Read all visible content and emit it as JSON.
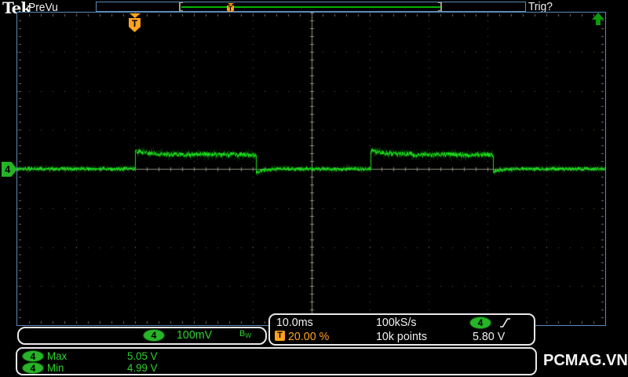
{
  "header": {
    "logo": "Tek",
    "mode": "PreVu",
    "trigger_status": "Trig?"
  },
  "record_bar": {
    "trigger_marker": "T"
  },
  "trigger_position_marker": "T",
  "channel_marker": {
    "channel": "4"
  },
  "channel_readout": {
    "channel": "4",
    "volts_per_div": "100mV",
    "bandwidth_b": "B",
    "bandwidth_w": "W"
  },
  "horizontal_readout": {
    "time_per_div": "10.0ms",
    "sample_rate": "100kS/s",
    "record_length": "10k points"
  },
  "trigger_readout": {
    "marker": "T",
    "position": "20.00 %",
    "source_channel": "4",
    "level": "5.80 V",
    "slope_icon": "rising-edge"
  },
  "measurements": {
    "rows": [
      {
        "channel": "4",
        "label": "Max",
        "value": "5.05 V"
      },
      {
        "channel": "4",
        "label": "Min",
        "value": "4.99 V"
      }
    ]
  },
  "watermark": "PCMAG.VN",
  "colors": {
    "accent_blue": "#5d8cb8",
    "trace_bright": "#1ce41c",
    "trace_dim": "#0b7a0b",
    "text_green": "#2fd12f",
    "badge_green": "#27b427",
    "orange": "#ffa21e",
    "bracket_tan": "#a89f78",
    "grid_dot": "#5a5a5a",
    "axis_gray": "#8f8c7e",
    "edge_tick": "#707070"
  },
  "chart_data": {
    "type": "line",
    "title": "CH4 pulse train (PreVu)",
    "xlabel": "time, 10.0 ms/div",
    "ylabel": "CH4, 100 mV/div",
    "x_range_ms": [
      0,
      100
    ],
    "divisions": {
      "horizontal": 10,
      "vertical": 8
    },
    "baseline_v": 4.99,
    "high_v": 5.05,
    "pulses_ms": [
      {
        "rise": 20.0,
        "fall": 40.5
      },
      {
        "rise": 60.0,
        "fall": 80.8
      }
    ],
    "trigger": {
      "position_pct": 20.0,
      "level_v": 5.8,
      "slope": "rising",
      "source": "CH4"
    },
    "display": {
      "baseline_at_div": 0,
      "high_div": 0.36,
      "overshoot_div": 0.1,
      "undershoot_div": 0.1,
      "noise_div": 0.04
    }
  }
}
